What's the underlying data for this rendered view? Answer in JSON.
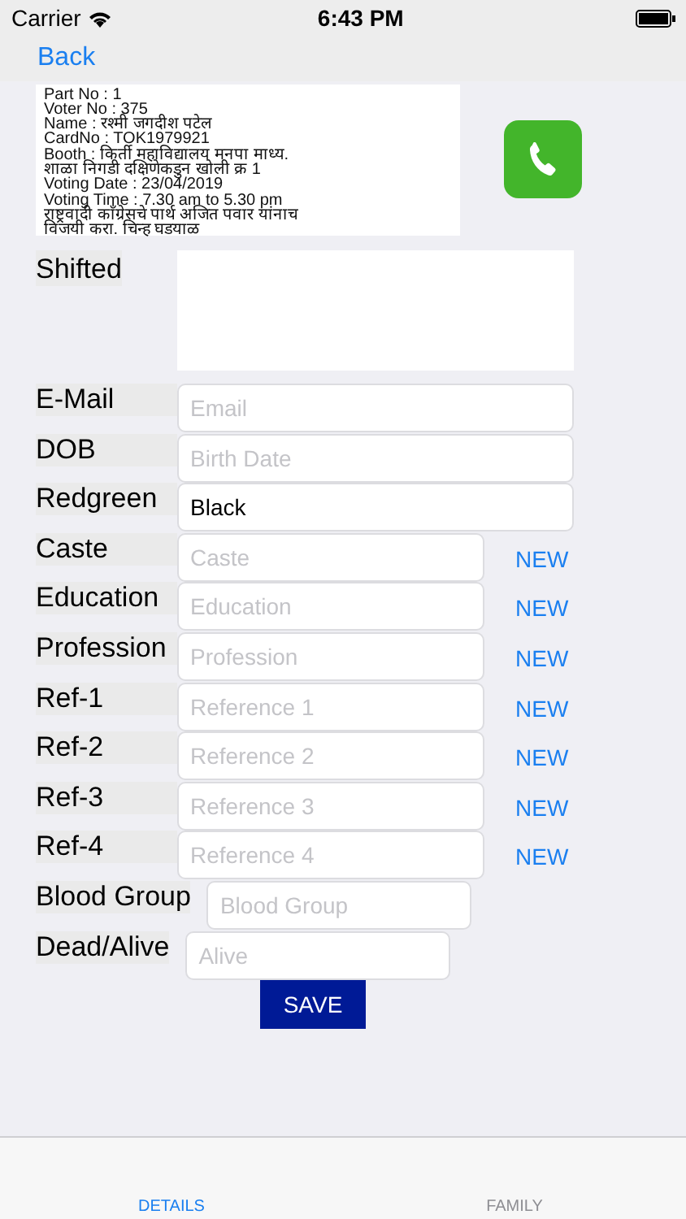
{
  "status_bar": {
    "carrier": "Carrier",
    "time": "6:43 PM"
  },
  "nav": {
    "back": "Back"
  },
  "info_lines": [
    "Part No : 1",
    "Voter No : 375",
    "Name : रश्मी जगदीश पटेल",
    "CardNo : TOK1979921",
    "Booth : किर्ती महाविद्यालय मनपा माध्य.",
    "शाळा निगडी दक्षिणेकडुन खोली क्र 1",
    "Voting Date : 23/04/2019",
    "Voting Time : 7.30 am to 5.30 pm",
    "राष्ट्रवादी कॉंग्रेसचे पार्थ अजित पवार यांनाच",
    "विजयी करा. चिन्ह घडयाळ"
  ],
  "shifted": {
    "label": "Shifted"
  },
  "fields": [
    {
      "label": "E-Mail",
      "placeholder": "Email",
      "kind": "full"
    },
    {
      "label": "DOB",
      "placeholder": "Birth Date",
      "kind": "full"
    },
    {
      "label": "Redgreen",
      "value": "Black",
      "kind": "full"
    },
    {
      "label": "Caste",
      "placeholder": "Caste",
      "kind": "new",
      "action": "NEW"
    },
    {
      "label": "Education",
      "placeholder": "Education",
      "kind": "new",
      "action": "NEW"
    },
    {
      "label": "Profession",
      "placeholder": "Profession",
      "kind": "new",
      "action": "NEW"
    },
    {
      "label": "Ref-1",
      "placeholder": "Reference 1",
      "kind": "new",
      "action": "NEW"
    },
    {
      "label": "Ref-2",
      "placeholder": "Reference 2",
      "kind": "new",
      "action": "NEW"
    },
    {
      "label": "Ref-3",
      "placeholder": "Reference 3",
      "kind": "new",
      "action": "NEW"
    },
    {
      "label": "Ref-4",
      "placeholder": "Reference 4",
      "kind": "new",
      "action": "NEW"
    },
    {
      "label": "Blood Group",
      "placeholder": "Blood Group",
      "kind": "short"
    },
    {
      "label": "Dead/Alive",
      "placeholder": "Alive",
      "kind": "short"
    }
  ],
  "save": "SAVE",
  "tabs": [
    {
      "label": "DETAILS",
      "selected": true
    },
    {
      "label": "FAMILY",
      "selected": false
    }
  ]
}
